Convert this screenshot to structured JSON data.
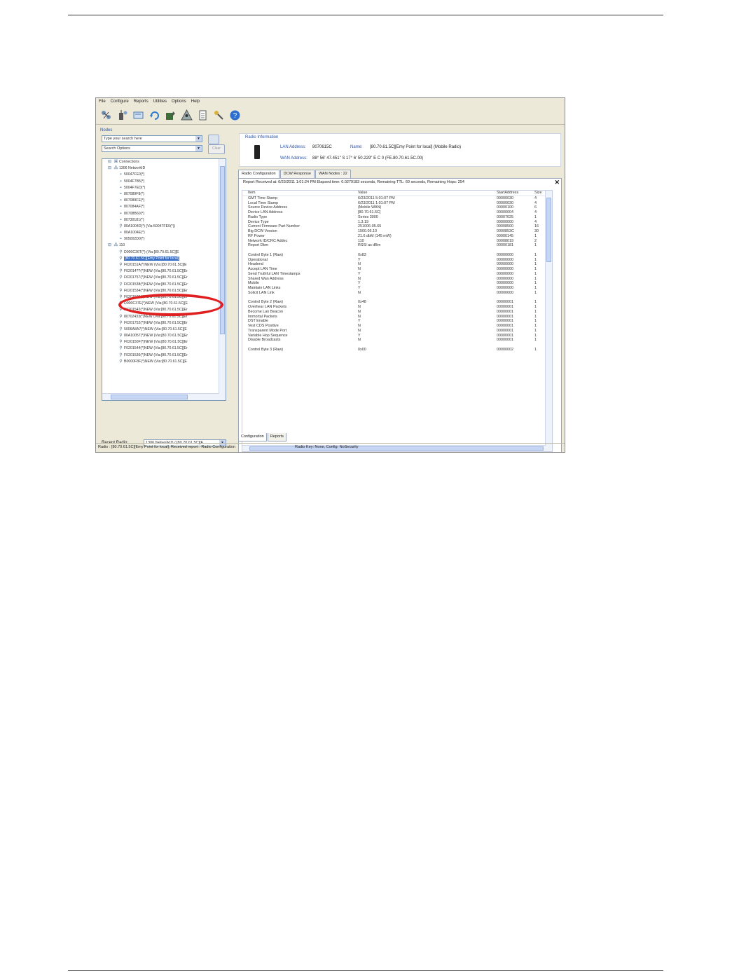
{
  "menu": [
    "File",
    "Configure",
    "Reports",
    "Utilities",
    "Options",
    "Help"
  ],
  "toolbar_icons": [
    "network-scan-icon",
    "radio-settings-icon",
    "terminal-icon",
    "refresh-icon",
    "map-tools-icon",
    "network-tree-icon",
    "report-document-icon",
    "keys-icon",
    "help-icon"
  ],
  "nodes": {
    "title": "Nodes",
    "search_value": "Type your search here",
    "search_options": "Search Options",
    "clear_label": "Clear",
    "tree": [
      {
        "indent": 1,
        "icon": "connections",
        "text": "Connections"
      },
      {
        "indent": 1,
        "icon": "network",
        "text": "1306 NetworkID"
      },
      {
        "indent": 2,
        "icon": "node",
        "text": "50047FE0(*)"
      },
      {
        "indent": 2,
        "icon": "node",
        "text": "5004F7B5(*)"
      },
      {
        "indent": 2,
        "icon": "node",
        "text": "5004F7ED(*)"
      },
      {
        "indent": 2,
        "icon": "node",
        "text": "807089F8(*)"
      },
      {
        "indent": 2,
        "icon": "node",
        "text": "807089FE(*)"
      },
      {
        "indent": 2,
        "icon": "node",
        "text": "807084AF(*)"
      },
      {
        "indent": 2,
        "icon": "node",
        "text": "80708B60(*)"
      },
      {
        "indent": 2,
        "icon": "node",
        "text": "80730181(*)"
      },
      {
        "indent": 2,
        "icon": "radio",
        "text": "80A1004D(*) (Via:50047FE0(*))"
      },
      {
        "indent": 2,
        "icon": "node",
        "text": "80A1004E(*)"
      },
      {
        "indent": 2,
        "icon": "node",
        "text": "905002D0(*)"
      },
      {
        "indent": 1,
        "icon": "network",
        "text": "110"
      },
      {
        "indent": 2,
        "icon": "radio",
        "text": "D000C36T(*) (Via:[80.70.61.5C][E"
      },
      {
        "indent": 2,
        "icon": "radio",
        "text": "[80.70.61.5C][Emy Point for local]",
        "selected": true
      },
      {
        "indent": 2,
        "icon": "radio",
        "text": "F020151A(*)NEW (Via:[80.70.61.5C][E"
      },
      {
        "indent": 2,
        "icon": "radio",
        "text": "F02014??(*)NEW (Via:[80.70.61.5C][Er"
      },
      {
        "indent": 2,
        "icon": "radio",
        "text": "F0201757(*)NEW (Via:[80.70.61.5C][Er"
      },
      {
        "indent": 2,
        "icon": "radio",
        "text": "F0201538(*)NEW (Via:[80.70.61.5C][Er"
      },
      {
        "indent": 2,
        "icon": "radio",
        "text": "F0201534(*)NEW (Via:[80.70.61.5C][Er"
      },
      {
        "indent": 2,
        "icon": "radio",
        "text": "F0201509(*)NEW (Via:[80.70.61.5C][Er"
      },
      {
        "indent": 2,
        "icon": "radio",
        "text": "D000C37E(*)NEW (Via:[80.70.61.5C][E"
      },
      {
        "indent": 2,
        "icon": "radio",
        "text": "F0201542(*)NEW (Via:[80.70.61.5C][Er"
      },
      {
        "indent": 2,
        "icon": "radio",
        "text": "80702433(*)NEW (Via:[80.70.61.5C][Er"
      },
      {
        "indent": 2,
        "icon": "radio",
        "text": "F0201752(*)NEW (Via:[80.70.61.5C][Er"
      },
      {
        "indent": 2,
        "icon": "radio",
        "text": "5006A8A7(*)NEW (Via:[80.70.61.5C][E"
      },
      {
        "indent": 2,
        "icon": "radio",
        "text": "80A10057(*)NEW (Via:[80.70.61.5C][Er"
      },
      {
        "indent": 2,
        "icon": "radio",
        "text": "F020150F(*)NEW (Via:[80.70.61.5C][Er"
      },
      {
        "indent": 2,
        "icon": "radio",
        "text": "F0201544(*)NEW (Via:[80.70.61.5C][Er"
      },
      {
        "indent": 2,
        "icon": "radio",
        "text": "F0201536(*)NEW (Via:[80.70.61.5C][Er"
      },
      {
        "indent": 2,
        "icon": "radio",
        "text": "B0000F8F(*)NEW (Via:[80.70.61.5C][E"
      }
    ],
    "recent_label": "Recent Radio:",
    "recent_value": "1306 NetworkID / [80.70.61.5C][E"
  },
  "radio_info": {
    "title": "Radio Information",
    "lan_label": "LAN Address:",
    "lan_value": "8070615C",
    "name_label": "Name:",
    "name_value": "[80.70.61.5C][Emy Point for local] (Mobile Radio)",
    "wan_label": "WAN Address:",
    "wan_value": "88° 56' 47.451\" S 17° 6' 50.229\" E C 0 (FE.80.70.61.5C.00)"
  },
  "tabs": [
    "Radio Configuration",
    "DCW Response",
    "WAN Nodes : 22"
  ],
  "report_header": "Report Received at: 6/23/2011 1:01:24 PM  Elapsed time: 0.0279183 seconds, Remaining TTL: 60 seconds, Remaining Hops: 254",
  "grid": {
    "columns": [
      "Item",
      "Value",
      "StartAddress",
      "Size"
    ],
    "rows": [
      [
        "GMT Time Stamp",
        "6/23/2011 5:01:07 PM",
        "00000030",
        "4"
      ],
      [
        "Local Time Stamp",
        "6/23/2011 1:01:07 PM",
        "00000030",
        "4"
      ],
      [
        "Source Device Address",
        "(Mobile WAN)",
        "00000100",
        "6"
      ],
      [
        "Device LAN Address",
        "[80.70.61.5C]",
        "00000004",
        "4"
      ],
      [
        "Radio Type",
        "Series 3000",
        "00007025",
        "1"
      ],
      [
        "Device Type",
        "1.3.19",
        "00000000",
        "4"
      ],
      [
        "Current Firmware Part Number",
        "251006-05.65",
        "00008500",
        "16"
      ],
      [
        "Big DCW Version",
        "1500.05.10",
        "0000853C",
        "30"
      ],
      [
        "RF Power",
        "21.6 dbM (145 mW)",
        "00000145",
        "1"
      ],
      [
        "Network ID/CRC Addec",
        "110",
        "00008019",
        "2"
      ],
      [
        "Report Dbm",
        "RSSI as dBm",
        "00000181",
        "1"
      ],
      [
        "",
        "",
        "",
        ""
      ],
      [
        "Control Byte 1 (Raw)",
        "0x83",
        "00000000",
        "1"
      ],
      [
        "Operational",
        "Y",
        "00000000",
        "1"
      ],
      [
        "Headend",
        "N",
        "00000000",
        "1"
      ],
      [
        "Accept LAN Time",
        "N",
        "00000000",
        "1"
      ],
      [
        "Send Truthful LAN Timestamps",
        "Y",
        "00000000",
        "1"
      ],
      [
        "Shared Wan Address",
        "N",
        "00000000",
        "1"
      ],
      [
        "Mobile",
        "Y",
        "00000000",
        "1"
      ],
      [
        "Maintain LAN Links",
        "Y",
        "00000000",
        "1"
      ],
      [
        "Solicit LAN Link",
        "N",
        "00000000",
        "1"
      ],
      [
        "",
        "",
        "",
        ""
      ],
      [
        "Control Byte 2 (Raw)",
        "0x48",
        "00000001",
        "1"
      ],
      [
        "Overhear LAN Packets",
        "N",
        "00000001",
        "1"
      ],
      [
        "Become Lan Beacon",
        "N",
        "00000001",
        "1"
      ],
      [
        "Immortal Packets",
        "N",
        "00000001",
        "1"
      ],
      [
        "DST Enable",
        "Y",
        "00000001",
        "1"
      ],
      [
        "Vest CDS Positive",
        "N",
        "00000001",
        "1"
      ],
      [
        "Transparent Mode Port",
        "N",
        "00000001",
        "1"
      ],
      [
        "Variable Hop Sequence",
        "Y",
        "00000001",
        "1"
      ],
      [
        "Disable Broadcasts",
        "N",
        "00000001",
        "1"
      ],
      [
        "",
        "",
        "",
        ""
      ],
      [
        "Control Byte 3 (Raw)",
        "0x00",
        "00000002",
        "1"
      ]
    ]
  },
  "bottom_tabs": [
    "Configuration",
    "Reports"
  ],
  "status": {
    "left": "Radio : [80.70.61.5C][Emy Point for local], Received report : Radio Configuration",
    "right": "Radio Key: None, Config: NoSecurity"
  }
}
